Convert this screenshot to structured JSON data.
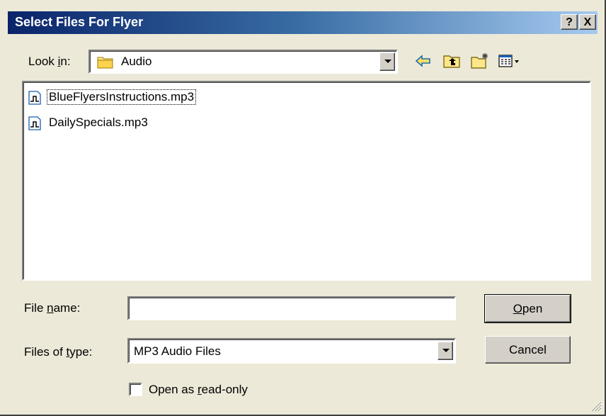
{
  "window": {
    "title": "Select Files For Flyer",
    "help_button": "?",
    "close_button": "X"
  },
  "look_in": {
    "label_pre": "Look ",
    "label_accel": "i",
    "label_post": "n:",
    "value": "Audio"
  },
  "toolbar": {
    "icons": [
      "back-arrow-icon",
      "up-one-level-icon",
      "create-new-folder-icon",
      "view-menu-icon"
    ]
  },
  "files": [
    {
      "name": "BlueFlyersInstructions.mp3",
      "focused": true
    },
    {
      "name": "DailySpecials.mp3",
      "focused": false
    }
  ],
  "file_name": {
    "label_pre": "File ",
    "label_accel": "n",
    "label_post": "ame:",
    "value": ""
  },
  "files_of_type": {
    "label_pre": "Files of ",
    "label_accel": "t",
    "label_post": "ype:",
    "value": "MP3 Audio Files"
  },
  "buttons": {
    "open_accel": "O",
    "open_rest": "pen",
    "cancel": "Cancel"
  },
  "read_only": {
    "label_pre": "Open as ",
    "label_accel": "r",
    "label_post": "ead-only",
    "checked": false
  },
  "colors": {
    "title_gradient_start": "#0a246a",
    "title_gradient_end": "#a6caf0",
    "dialog_background": "#ece9d8"
  }
}
